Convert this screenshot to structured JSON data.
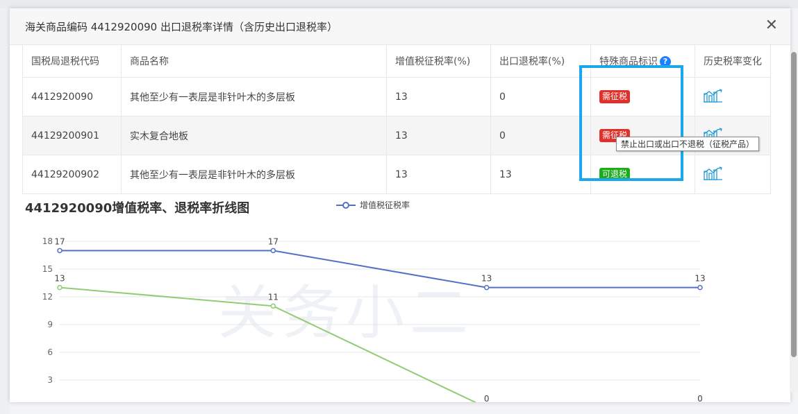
{
  "modal": {
    "title": "海关商品编码 4412920090 出口退税率详情（含历史出口退税率）",
    "close_icon": "close-icon"
  },
  "table": {
    "headers": [
      "国税局退税代码",
      "商品名称",
      "增值税征税率(%)",
      "出口退税率(%)",
      "特殊商品标识",
      "历史税率变化"
    ],
    "help_icon": "question-icon",
    "rows": [
      {
        "code": "4412920090",
        "name": "其他至少有一表层是非针叶木的多层板",
        "vat": "13",
        "refund": "0",
        "badge": "需征税",
        "badge_color": "#e0302a",
        "trend_icon": "trend-chart-icon"
      },
      {
        "code": "44129200901",
        "name": "实木复合地板",
        "vat": "13",
        "refund": "0",
        "badge": "需征税",
        "badge_color": "#e0302a",
        "trend_icon": "trend-chart-icon"
      },
      {
        "code": "44129200902",
        "name": "其他至少有一表层是非针叶木的多层板",
        "vat": "13",
        "refund": "13",
        "badge": "可退税",
        "badge_color": "#1aad19",
        "trend_icon": "trend-chart-icon"
      }
    ]
  },
  "tooltip": "禁止出口或出口不退税（征税产品）",
  "watermark": "关务小二",
  "chart_data": {
    "type": "line",
    "title": "4412920090增值税率、退税率折线图",
    "categories": [
      "",
      "",
      "",
      ""
    ],
    "yticks": [
      3,
      6,
      9,
      12,
      15,
      18
    ],
    "ylim": [
      0,
      18
    ],
    "grid": true,
    "legend": "top",
    "series": [
      {
        "name": "增值税征税率",
        "color": "#5470c6",
        "values": [
          17,
          17,
          13,
          13
        ]
      },
      {
        "color": "#91cc75",
        "values": [
          13,
          11,
          0,
          0
        ]
      }
    ]
  }
}
